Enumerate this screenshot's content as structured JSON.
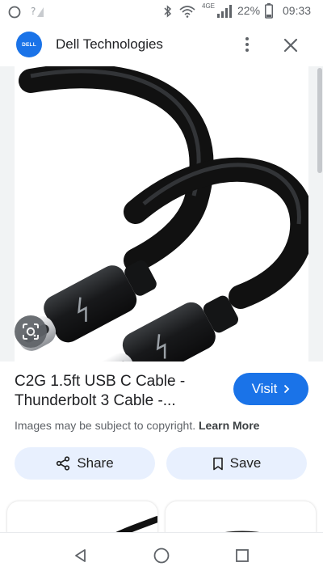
{
  "status_bar": {
    "battery_percent": "22%",
    "network_label": "4GE",
    "time": "09:33"
  },
  "header": {
    "logo_text": "DELL",
    "site_name": "Dell Technologies",
    "icons": [
      "more-vert-icon",
      "close-icon"
    ]
  },
  "product": {
    "title_line1": "C2G 1.5ft USB C Cable -",
    "title_line2": "Thunderbolt 3 Cable -...",
    "visit_label": "Visit",
    "copyright_text": "Images may be subject to copyright.",
    "learn_more_label": "Learn More"
  },
  "actions": {
    "share_label": "Share",
    "save_label": "Save"
  },
  "colors": {
    "accent": "#1a73e8",
    "action_bg": "#e8f0fe",
    "text_primary": "#202124",
    "text_secondary": "#5f6368"
  }
}
